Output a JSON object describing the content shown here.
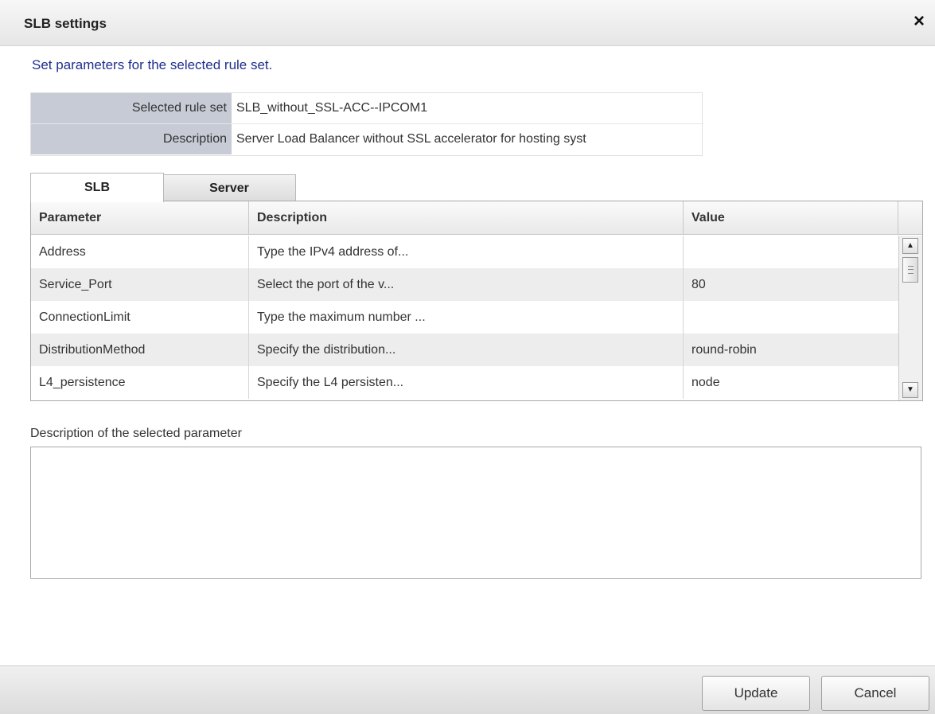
{
  "dialog": {
    "title": "SLB settings",
    "close_symbol": "×"
  },
  "instruction": "Set parameters for the selected rule set.",
  "ruleset": {
    "selected_label": "Selected rule set",
    "selected_value": "SLB_without_SSL-ACC--IPCOM1",
    "description_label": "Description",
    "description_value": "Server Load Balancer without SSL accelerator for hosting syst"
  },
  "tabs": [
    {
      "label": "SLB",
      "active": true
    },
    {
      "label": "Server",
      "active": false
    }
  ],
  "grid": {
    "headers": [
      "Parameter",
      "Description",
      "Value"
    ],
    "rows": [
      {
        "parameter": "Address",
        "description": "Type the IPv4 address of...",
        "value": ""
      },
      {
        "parameter": "Service_Port",
        "description": "Select the port of the v...",
        "value": "80"
      },
      {
        "parameter": "ConnectionLimit",
        "description": "Type the maximum number ...",
        "value": ""
      },
      {
        "parameter": "DistributionMethod",
        "description": "Specify the distribution...",
        "value": "round-robin"
      },
      {
        "parameter": "L4_persistence",
        "description": "Specify the L4 persisten...",
        "value": "node"
      }
    ],
    "scroll_up_icon": "▲",
    "scroll_down_icon": "▼"
  },
  "selected_parameter": {
    "label": "Description of the selected parameter",
    "text": ""
  },
  "footer": {
    "update_label": "Update",
    "cancel_label": "Cancel"
  }
}
